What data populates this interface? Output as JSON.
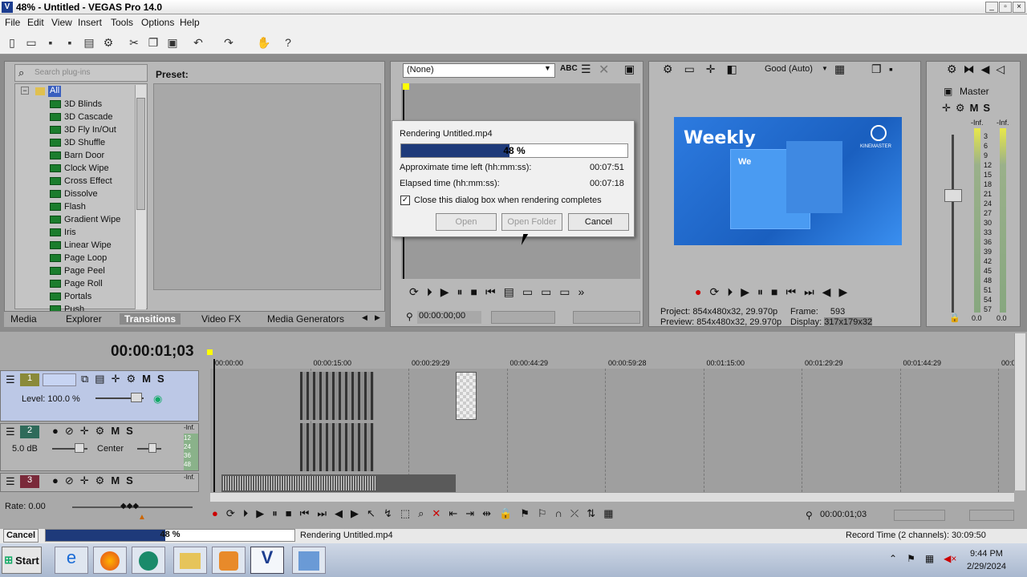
{
  "window": {
    "title": "48% - Untitled - VEGAS Pro 14.0"
  },
  "menu": [
    "File",
    "Edit",
    "View",
    "Insert",
    "Tools",
    "Options",
    "Help"
  ],
  "plugins": {
    "search_placeholder": "Search plug-ins",
    "root": "All",
    "items": [
      "3D Blinds",
      "3D Cascade",
      "3D Fly In/Out",
      "3D Shuffle",
      "Barn Door",
      "Clock Wipe",
      "Cross Effect",
      "Dissolve",
      "Flash",
      "Gradient Wipe",
      "Iris",
      "Linear Wipe",
      "Page Loop",
      "Page Peel",
      "Page Roll",
      "Portals",
      "Push"
    ],
    "preset_label": "Preset:"
  },
  "tabs": [
    "Media",
    "Explorer",
    "Transitions",
    "Video FX",
    "Media Generators"
  ],
  "active_tab": "Transitions",
  "trimmer": {
    "select_value": "(None)",
    "time": "00:00:00;00"
  },
  "preview": {
    "quality": "Good (Auto)",
    "project_label": "Project:",
    "project_value": "854x480x32, 29.970p",
    "preview_label": "Preview:",
    "preview_value": "854x480x32, 29.970p",
    "frame_label": "Frame:",
    "frame_value": "593",
    "display_label": "Display:",
    "display_value": "317x179x32",
    "thumb_title": "Weekly",
    "thumb_sub": "We",
    "thumb_brand": "KINEMASTER"
  },
  "master": {
    "label": "Master",
    "left": "-Inf.",
    "right": "-Inf.",
    "scale": [
      "3",
      "6",
      "9",
      "12",
      "15",
      "18",
      "21",
      "24",
      "27",
      "30",
      "33",
      "36",
      "39",
      "42",
      "45",
      "48",
      "51",
      "54",
      "57"
    ],
    "val_l": "0.0",
    "val_r": "0.0"
  },
  "dialog": {
    "title": "Rendering Untitled.mp4",
    "progress_text": "48 %",
    "progress": 0.48,
    "time_left_label": "Approximate time left (hh:mm:ss):",
    "time_left": "00:07:51",
    "elapsed_label": "Elapsed time (hh:mm:ss):",
    "elapsed": "00:07:18",
    "checkbox_label": "Close this dialog box when rendering completes",
    "btn_open": "Open",
    "btn_open_folder": "Open Folder",
    "btn_cancel": "Cancel"
  },
  "timeline": {
    "time": "00:00:01;03",
    "ruler": [
      "00:00:00",
      "00:00:15:00",
      "00:00:29:29",
      "00:00:44:29",
      "00:00:59:28",
      "00:01:15:00",
      "00:01:29:29",
      "00:01:44:29",
      "00:0"
    ],
    "track1": {
      "num": "1",
      "level": "Level: 100.0 %"
    },
    "track2": {
      "num": "2",
      "db": "5.0 dB",
      "pan": "Center",
      "inf": "-Inf.",
      "meter": [
        "12",
        "24",
        "36",
        "48"
      ]
    },
    "track3": {
      "num": "3",
      "inf": "-Inf."
    },
    "rate": "Rate: 0.00",
    "time_bottom": "00:00:01;03"
  },
  "status": {
    "cancel": "Cancel",
    "progress_text": "48 %",
    "progress": 0.48,
    "message": "Rendering Untitled.mp4",
    "record_time": "Record Time (2 channels): 30:09:50"
  },
  "taskbar": {
    "start": "Start",
    "time": "9:44 PM",
    "date": "2/29/2024"
  }
}
